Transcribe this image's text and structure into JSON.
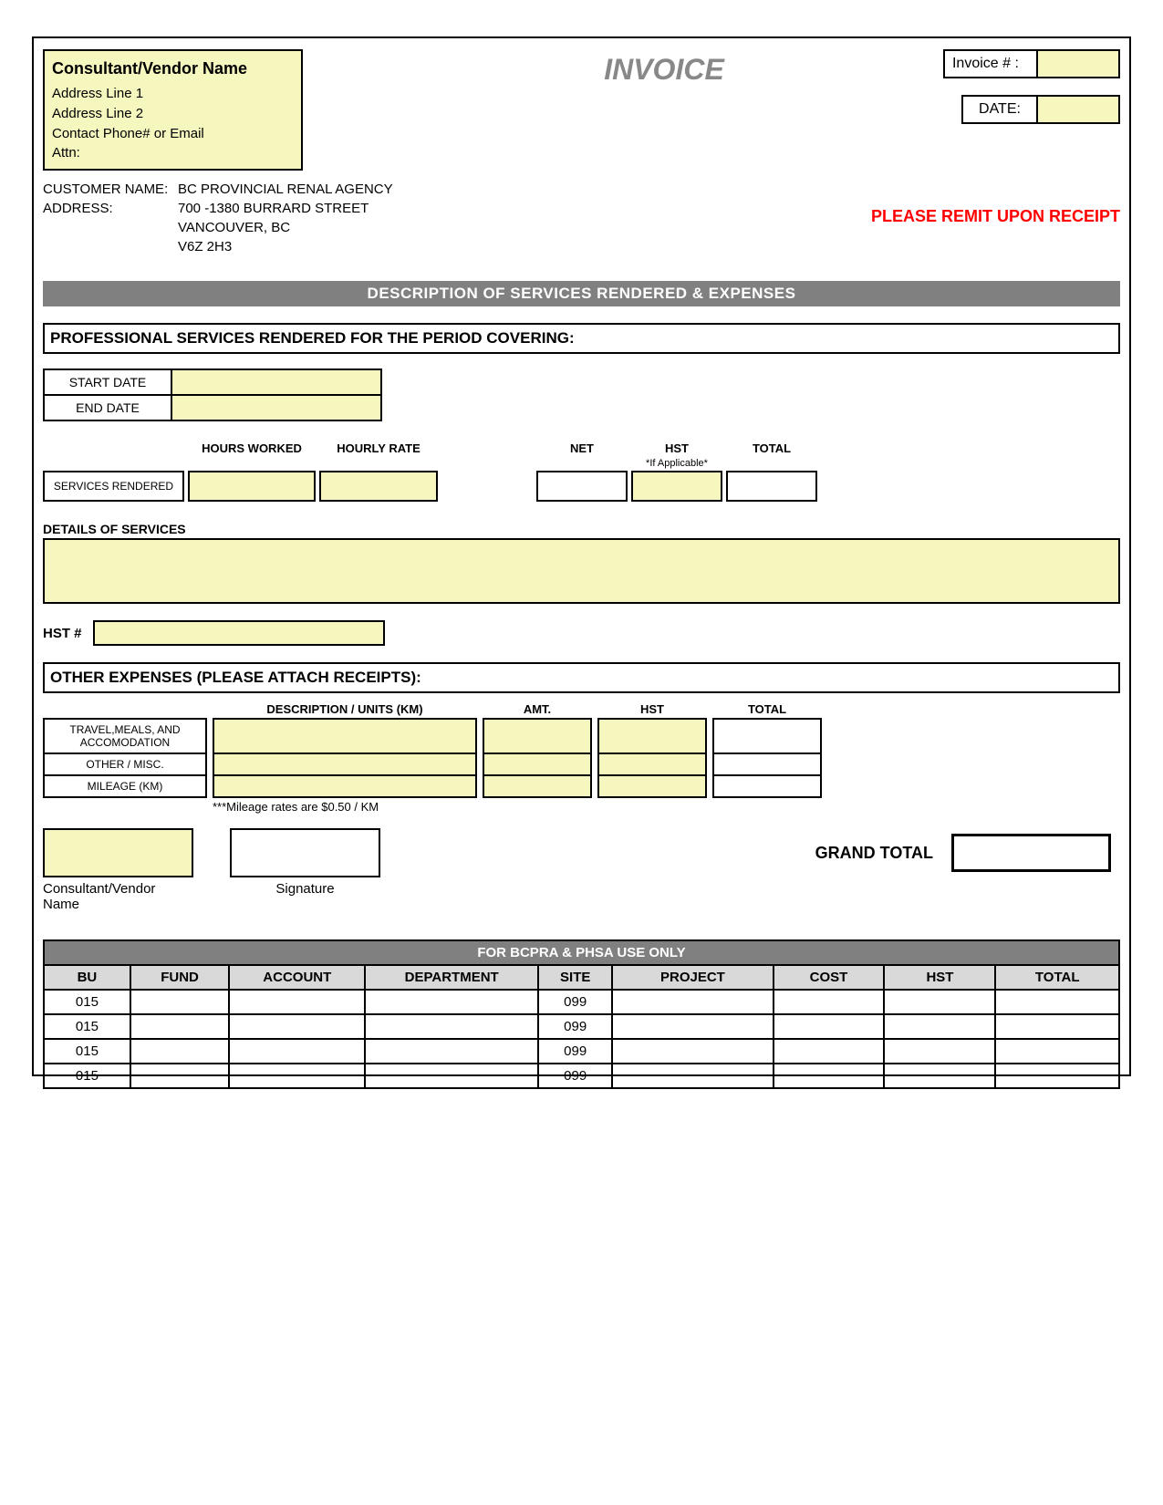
{
  "title": "INVOICE",
  "vendor_box": {
    "name": "Consultant/Vendor Name",
    "line1": "Address Line 1",
    "line2": "Address Line 2",
    "contact": "Contact Phone# or Email",
    "attn": "Attn:"
  },
  "invoice_num_label": "Invoice # :",
  "date_label": "DATE:",
  "customer": {
    "name_label": "CUSTOMER NAME:",
    "addr_label": "ADDRESS:",
    "name": "BC PROVINCIAL RENAL AGENCY",
    "addr1": "700 -1380 BURRARD STREET",
    "addr2": "VANCOUVER, BC",
    "addr3": "V6Z 2H3"
  },
  "remit": "PLEASE REMIT UPON RECEIPT",
  "section_bar": "DESCRIPTION OF SERVICES RENDERED & EXPENSES",
  "prof_header": "PROFESSIONAL SERVICES RENDERED FOR THE PERIOD COVERING:",
  "dates": {
    "start": "START DATE",
    "end": "END DATE"
  },
  "svc_cols": {
    "hours": "HOURS WORKED",
    "rate": "HOURLY RATE",
    "net": "NET",
    "hst": "HST",
    "hst_note": "*If Applicable*",
    "total": "TOTAL"
  },
  "svc_row_label": "SERVICES RENDERED",
  "details_label": "DETAILS OF SERVICES",
  "hst_label": "HST #",
  "expenses_header": "OTHER EXPENSES (PLEASE ATTACH RECEIPTS):",
  "exp_cols": {
    "desc": "DESCRIPTION / UNITS (KM)",
    "amt": "AMT.",
    "hst": "HST",
    "total": "TOTAL"
  },
  "exp_rows": {
    "travel": "TRAVEL,MEALS, AND ACCOMODATION",
    "other": "OTHER / MISC.",
    "mileage": "MILEAGE (KM)"
  },
  "mileage_note": "***Mileage rates are $0.50 / KM",
  "sig": {
    "name_label": "Consultant/Vendor Name",
    "sig_label": "Signature"
  },
  "grand_total": "GRAND TOTAL",
  "use_header": "FOR BCPRA & PHSA USE ONLY",
  "use_cols": [
    "BU",
    "FUND",
    "ACCOUNT",
    "DEPARTMENT",
    "SITE",
    "PROJECT",
    "COST",
    "HST",
    "TOTAL"
  ],
  "use_rows": [
    {
      "bu": "015",
      "site": "099"
    },
    {
      "bu": "015",
      "site": "099"
    },
    {
      "bu": "015",
      "site": "099"
    },
    {
      "bu": "015",
      "site": "099"
    }
  ]
}
